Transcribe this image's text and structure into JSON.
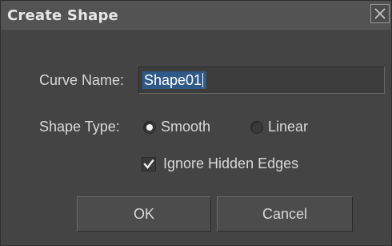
{
  "dialog": {
    "title": "Create Shape",
    "close_glyph": "✕"
  },
  "form": {
    "curve_name_label": "Curve Name:",
    "curve_name_value": "Shape01",
    "shape_type_label": "Shape Type:",
    "shape_type_options": [
      {
        "label": "Smooth",
        "selected": true
      },
      {
        "label": "Linear",
        "selected": false
      }
    ],
    "ignore_hidden_edges_label": "Ignore Hidden Edges",
    "ignore_hidden_edges_checked": true
  },
  "buttons": {
    "ok_label": "OK",
    "cancel_label": "Cancel"
  },
  "colors": {
    "panel": "#444444",
    "selection": "#2f5a88"
  },
  "icons": {
    "close": "close-icon",
    "check": "checkmark-icon"
  }
}
